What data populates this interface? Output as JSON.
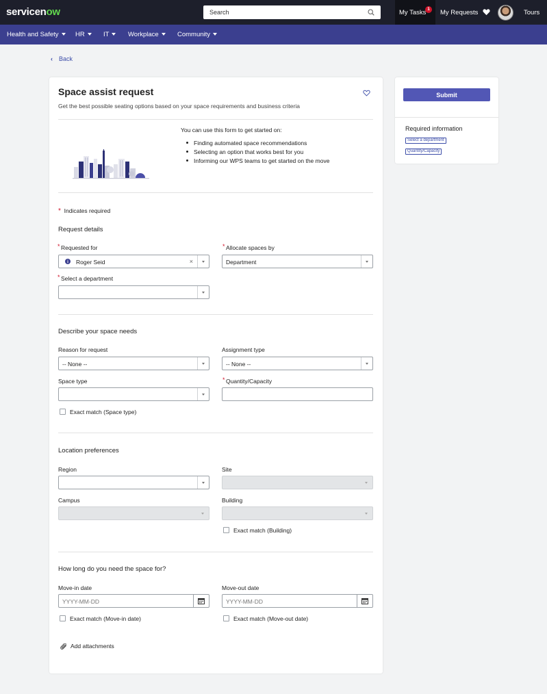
{
  "topbar": {
    "logo_text_a": "servicen",
    "logo_text_b": "ow",
    "search_placeholder": "Search",
    "my_tasks": "My Tasks",
    "my_tasks_count": "1",
    "my_requests": "My Requests",
    "tours": "Tours"
  },
  "nav": [
    {
      "label": "Health and Safety"
    },
    {
      "label": "HR"
    },
    {
      "label": "IT"
    },
    {
      "label": "Workplace"
    },
    {
      "label": "Community"
    }
  ],
  "back_label": "Back",
  "form": {
    "title": "Space assist request",
    "subtitle": "Get the best possible seating options based on your space requirements and business criteria",
    "intro_heading": "You can use this form to get started on:",
    "intro_bullets": [
      "Finding automated space recommendations",
      "Selecting an option that works best for you",
      "Informing our WPS teams to get started on the move"
    ],
    "required_note": "Indicates required",
    "sections": {
      "request_details": "Request details",
      "space_needs": "Describe your space needs",
      "location": "Location preferences",
      "duration": "How long do you need the space for?"
    },
    "fields": {
      "requested_for_label": "Requested for",
      "requested_for_value": "Roger Seid",
      "allocate_label": "Allocate spaces by",
      "allocate_value": "Department",
      "department_label": "Select a department",
      "reason_label": "Reason for request",
      "reason_value": "-- None --",
      "assignment_label": "Assignment type",
      "assignment_value": "-- None --",
      "space_type_label": "Space type",
      "quantity_label": "Quantity/Capacity",
      "exact_space_type": "Exact match (Space type)",
      "region_label": "Region",
      "site_label": "Site",
      "campus_label": "Campus",
      "building_label": "Building",
      "exact_building": "Exact match (Building)",
      "movein_label": "Move-in date",
      "movein_placeholder": "YYYY-MM-DD",
      "moveout_label": "Move-out date",
      "moveout_placeholder": "YYYY-MM-DD",
      "exact_movein": "Exact match (Move-in date)",
      "exact_moveout": "Exact match (Move-out date)"
    },
    "add_attachments": "Add attachments"
  },
  "sidebar": {
    "submit": "Submit",
    "required_info": "Required information",
    "tags": [
      "Select a department",
      "Quantity/Capacity"
    ]
  },
  "colors": {
    "topbar": "#1d1f2b",
    "navbar": "#3b3f8f",
    "accent": "#5257b5",
    "link": "#3b4ca8",
    "required": "#d0152b"
  }
}
